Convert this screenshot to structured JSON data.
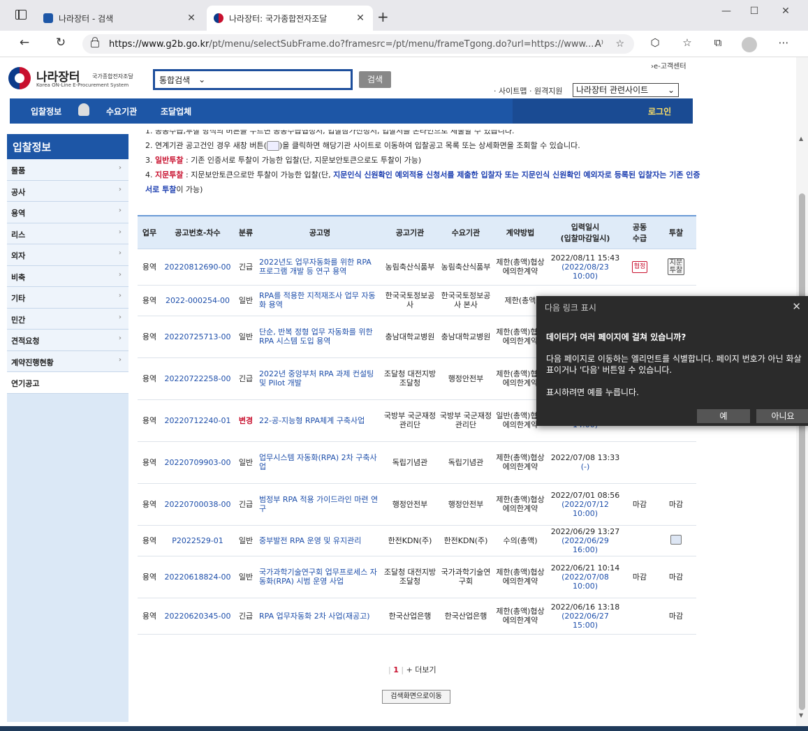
{
  "browser": {
    "tabs": [
      {
        "title": "나라장터 - 검색",
        "active": false
      },
      {
        "title": "나라장터: 국가종합전자조달",
        "active": true
      }
    ],
    "url_host": "https://www.g2b.go.kr",
    "url_path": "/pt/menu/selectSubFrame.do?framesrc=/pt/menu/frameTgong.do?url=https://www...."
  },
  "site": {
    "logo_main": "나라장터",
    "logo_sub1": "국가종합전자조달",
    "logo_sub2": "Korea ON-Line E-Procurement System",
    "search_select": "통합검색",
    "search_button": "검색",
    "customer_center": "›e-고객센터",
    "sitemap_links": "· 사이트맵 · 원격지원",
    "related_sites": "나라장터 관련사이트",
    "gnb": [
      "입찰정보",
      "수요기관",
      "조달업체"
    ],
    "login": "로그인"
  },
  "sidebar": {
    "title": "입찰정보",
    "items": [
      "물품",
      "공사",
      "용역",
      "리스",
      "외자",
      "비축",
      "기타",
      "민간",
      "견적요청",
      "계약진행현황",
      "연기공고"
    ]
  },
  "notices": {
    "line1": "1. 공동수급,투찰 방식의 버튼을 누르면 공동수급협정서, 입찰참가신청서, 입찰서를 온라인으로 제출할 수 있습니다.",
    "line2a": "2. 연계기관 공고건인 경우 새창 버튼(",
    "line2b": ")을 클릭하면 해당기관 사이트로 이동하여 입찰공고 목록 또는 상세화면을 조회할 수 있습니다.",
    "line3_label": "일반투찰",
    "line3_text": " : 기존 인증서로 투찰이 가능한 입찰(단, 지문보안토큰으로도 투찰이 가능)",
    "line4_label": "지문투찰",
    "line4_text": " : 지문보안토큰으로만 투찰이 가능한 입찰(단, ",
    "line4_blue": "지문인식 신원확인 예외적용 신청서를 제출한 입찰자 또는 지문인식 신원확인 예외자로 등록된 입찰자는 기존 인증서로 투찰",
    "line4_end": "이 가능)"
  },
  "table": {
    "headers": [
      "업무",
      "공고번호-차수",
      "분류",
      "공고명",
      "공고기관",
      "수요기관",
      "계약방법",
      "입력일시\n(입찰마감일시)",
      "공동\n수급",
      "투찰"
    ],
    "rows": [
      {
        "biz": "용역",
        "no": "20220812690-00",
        "cat": "긴급",
        "name": "2022년도 업무자동화를 위한 RPA 프로그램 개발 등 연구 용역",
        "org": "농림축산식품부",
        "dem": "농림축산식품부",
        "method": "제한(총액)협상에의한계약",
        "date": "2022/08/11 15:43",
        "deadline": "(2022/08/23 10:00)",
        "joint": "협정",
        "bid": "지문\n투찰"
      },
      {
        "biz": "용역",
        "no": "2022-000254-00",
        "cat": "일반",
        "name": "RPA를 적용한 지적재조사 업무 자동화 용역",
        "org": "한국국토정보공사",
        "dem": "한국국토정보공사 본사",
        "method": "제한(총액",
        "date": "",
        "deadline": "",
        "joint": "",
        "bid": ""
      },
      {
        "biz": "용역",
        "no": "20220725713-00",
        "cat": "일반",
        "name": "단순, 반복 정형 업무 자동화를 위한 RPA 시스템 도입 용역",
        "org": "충남대학교병원",
        "dem": "충남대학교병원",
        "method": "제한(총액)협상에의한계약",
        "date": "",
        "deadline": "",
        "joint": "",
        "bid": ""
      },
      {
        "biz": "용역",
        "no": "20220722258-00",
        "cat": "긴급",
        "name": "2022년 중앙부처 RPA 과제 컨설팅 및 Pilot 개발",
        "org": "조달청 대전지방조달청",
        "dem": "행정안전부",
        "method": "제한(총액)협상에의한계약",
        "date": "",
        "deadline": "",
        "joint": "",
        "bid": ""
      },
      {
        "biz": "용역",
        "no": "20220712240-01",
        "cat": "변경",
        "name": "22-공-지능형 RPA체계 구축사업",
        "org": "국방부 국군재정관리단",
        "dem": "국방부 국군재정관리단",
        "method": "일반(총액)협상에의한계약",
        "date": "",
        "deadline": "(2022/08/04 14:00)",
        "joint": "",
        "bid": ""
      },
      {
        "biz": "용역",
        "no": "20220709903-00",
        "cat": "일반",
        "name": "업무시스템 자동화(RPA) 2차 구축사업",
        "org": "독립기념관",
        "dem": "독립기념관",
        "method": "제한(총액)협상에의한계약",
        "date": "2022/07/08 13:33",
        "deadline": "(-)",
        "joint": "",
        "bid": ""
      },
      {
        "biz": "용역",
        "no": "20220700038-00",
        "cat": "긴급",
        "name": "범정부 RPA 적용 가이드라인 마련 연구",
        "org": "행정안전부",
        "dem": "행정안전부",
        "method": "제한(총액)협상에의한계약",
        "date": "2022/07/01 08:56",
        "deadline": "(2022/07/12 10:00)",
        "joint": "마감",
        "bid": "마감"
      },
      {
        "biz": "용역",
        "no": "P2022529-01",
        "cat": "일반",
        "name": "중부발전 RPA 운영 및 유지관리",
        "org": "한전KDN(주)",
        "dem": "한전KDN(주)",
        "method": "수의(총액)",
        "date": "2022/06/29 13:27",
        "deadline": "(2022/06/29 16:00)",
        "joint": "",
        "bid": "icon"
      },
      {
        "biz": "용역",
        "no": "20220618824-00",
        "cat": "일반",
        "name": "국가과학기술연구회 업무프로세스 자동화(RPA) 시범 운영 사업",
        "org": "조달청 대전지방조달청",
        "dem": "국가과학기술연구회",
        "method": "제한(총액)협상에의한계약",
        "date": "2022/06/21 10:14",
        "deadline": "(2022/07/08 10:00)",
        "joint": "마감",
        "bid": "마감"
      },
      {
        "biz": "용역",
        "no": "20220620345-00",
        "cat": "긴급",
        "name": "RPA 업무자동화 2차 사업(재공고)",
        "org": "한국산업은행",
        "dem": "한국산업은행",
        "method": "제한(총액)협상에의한계약",
        "date": "2022/06/16 13:18",
        "deadline": "(2022/06/27 15:00)",
        "joint": "",
        "bid": "마감"
      }
    ]
  },
  "pager": {
    "current": "1",
    "more": "+ 더보기",
    "back": "검색화면으로이동"
  },
  "popup": {
    "title": "다음 링크 표시",
    "question": "데이터가 여러 페이지에 걸쳐 있습니까?",
    "desc": "다음 페이지로 이동하는 엘리먼트를 식별합니다. 페이지 번호가 아닌 화살표이거나 '다음' 버튼일 수 있습니다.",
    "hint": "표시하려면 예를 누릅니다.",
    "yes": "예",
    "no": "아니요"
  }
}
